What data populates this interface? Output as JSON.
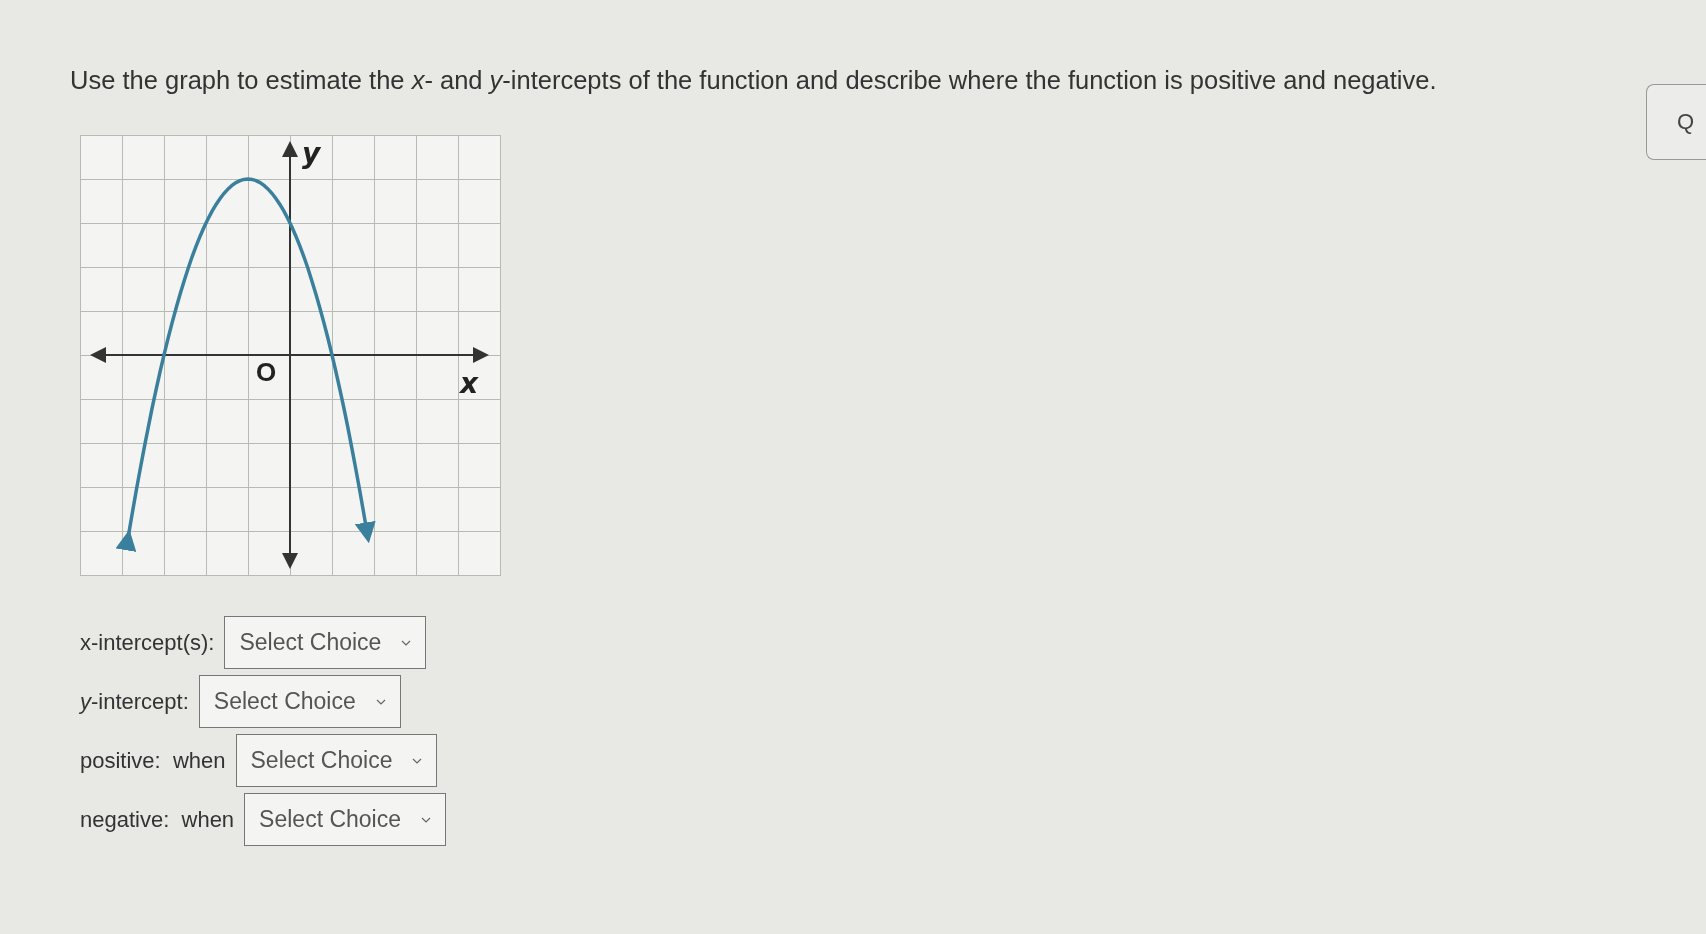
{
  "question": "Use the graph to estimate the *x*- and *y*-intercepts of the function and describe where the function is positive and negative.",
  "side_button": {
    "label": "Q"
  },
  "graph": {
    "y_label": "y",
    "x_label": "x",
    "origin_label": "O"
  },
  "answers": [
    {
      "label": "x-intercept(s):",
      "select": "Select Choice"
    },
    {
      "label": "*y*-intercept:",
      "select": "Select Choice"
    },
    {
      "label": "positive:  when",
      "select": "Select Choice"
    },
    {
      "label": "negative:  when",
      "select": "Select Choice"
    }
  ]
}
